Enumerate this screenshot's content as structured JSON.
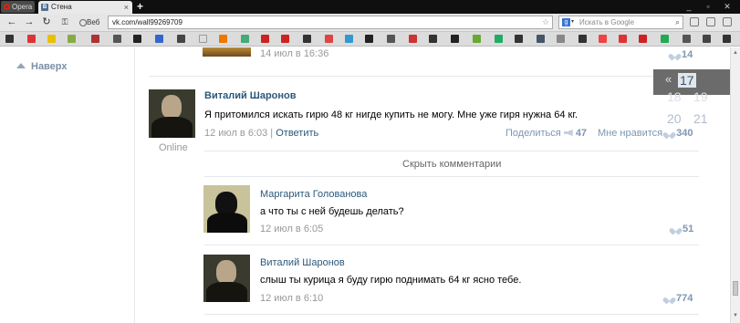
{
  "browser": {
    "menu_label": "Opera",
    "tab_title": "Стена",
    "tab_favicon": "В",
    "web_label": "Веб",
    "url": "vk.com/wall99269709",
    "search_placeholder": "Искать в Google",
    "window_controls": [
      "_",
      "▫",
      "✕"
    ]
  },
  "sidebar": {
    "up_label": "Наверх"
  },
  "calendar": {
    "prev": "«",
    "days": [
      "17",
      "18",
      "19",
      "20",
      "21"
    ]
  },
  "posts": {
    "top_time": "14 июл в 16:36",
    "top_likes": "14",
    "main": {
      "author": "Виталий Шаронов",
      "status": "Online",
      "text": "Я притомился искать гирю 48 кг нигде купить не могу. Мне уже гиря нужна 64 кг.",
      "time": "12 июл в 6:03",
      "separator": "|",
      "reply_label": "Ответить",
      "share_label": "Поделиться",
      "share_count": "47",
      "like_label": "Мне нравится",
      "like_count": "340"
    },
    "hide_comments_label": "Скрыть комментарии",
    "comments": [
      {
        "author": "Маргарита Голованова",
        "text": "а что ты с ней будешь делать?",
        "time": "12 июл в 6:05",
        "likes": "51"
      },
      {
        "author": "Виталий Шаронов",
        "text": "слыш ты курица я буду гирю поднимать 64 кг ясно тебе.",
        "time": "12 июл в 6:10",
        "likes": "774"
      }
    ]
  },
  "colors": {
    "link": "#2b587a",
    "muted": "#999999",
    "likes": "#7d96b2",
    "divider": "#e7e8ec"
  },
  "icons": [
    "opera-logo-icon",
    "back-icon",
    "forward-icon",
    "reload-icon",
    "key-icon",
    "star-icon",
    "google-icon",
    "search-icon",
    "heart-icon",
    "megaphone-icon",
    "up-arrow-icon"
  ]
}
